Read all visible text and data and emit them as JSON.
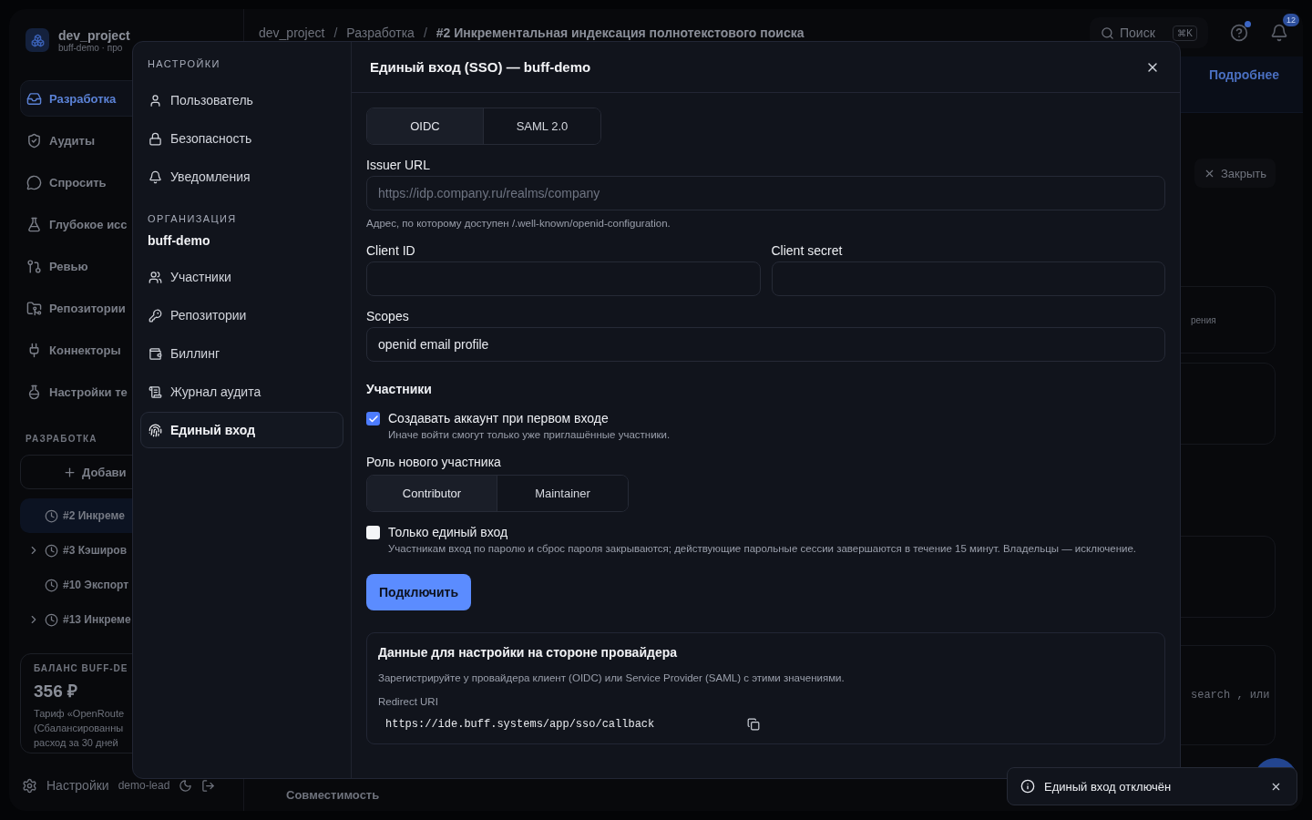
{
  "background": {
    "project": {
      "name": "dev_project",
      "subtitle": "buff-demo · про"
    },
    "nav": [
      {
        "label": "Разработка",
        "selected": true
      },
      {
        "label": "Аудиты",
        "selected": false
      },
      {
        "label": "Спросить",
        "selected": false
      },
      {
        "label": "Глубокое исс",
        "selected": false
      },
      {
        "label": "Ревью",
        "selected": false
      },
      {
        "label": "Репозитории",
        "selected": false
      },
      {
        "label": "Коннекторы",
        "selected": false
      },
      {
        "label": "Настройки те",
        "selected": false
      }
    ],
    "section_title": "РАЗРАБОТКА",
    "add_button": "Добави",
    "tasks": [
      {
        "label": "#2 Инкреме",
        "selected": true,
        "expandable": false
      },
      {
        "label": "#3 Кэширов",
        "selected": false,
        "expandable": true
      },
      {
        "label": "#10 Экспорт",
        "selected": false,
        "expandable": false
      },
      {
        "label": "#13 Инкреме",
        "selected": false,
        "expandable": true
      }
    ],
    "balance": {
      "title": "БАЛАНС BUFF-DE",
      "amount": "356 ₽",
      "lines": [
        "Тариф «OpenRoute",
        "(Сбалансированны",
        "расход за 30 дней"
      ]
    },
    "footer": {
      "settings": "Настройки",
      "user": "demo-lead"
    },
    "breadcrumbs": [
      "dev_project",
      "Разработка",
      "#2 Инкрементальная индексация полнотекстового поиска"
    ],
    "breadcrumb_separator": "/",
    "search": {
      "placeholder": "Поиск",
      "shortcut": "⌘K"
    },
    "notifications_count": "12",
    "banner_link": "Подробнее",
    "close_button": "Закрыть",
    "fragments": [
      "рения",
      "search , или"
    ],
    "bottom_tab": "Совместимость"
  },
  "modal": {
    "sidebar": {
      "title": "НАСТРОЙКИ",
      "items": [
        {
          "label": "Пользователь",
          "selected": false
        },
        {
          "label": "Безопасность",
          "selected": false
        },
        {
          "label": "Уведомления",
          "selected": false
        }
      ],
      "org_title": "ОРГАНИЗАЦИЯ",
      "org_name": "buff-demo",
      "org_items": [
        {
          "label": "Участники",
          "selected": false
        },
        {
          "label": "Репозитории",
          "selected": false
        },
        {
          "label": "Биллинг",
          "selected": false
        },
        {
          "label": "Журнал аудита",
          "selected": false
        },
        {
          "label": "Единый вход",
          "selected": true
        }
      ]
    },
    "title": "Единый вход (SSO) — buff-demo",
    "protocol": [
      {
        "label": "OIDC",
        "selected": true
      },
      {
        "label": "SAML 2.0",
        "selected": false
      }
    ],
    "issuer": {
      "label": "Issuer URL",
      "placeholder": "https://idp.company.ru/realms/company",
      "hint": "Адрес, по которому доступен /.well-known/openid-configuration."
    },
    "client_id": {
      "label": "Client ID"
    },
    "client_secret": {
      "label": "Client secret"
    },
    "scopes": {
      "label": "Scopes",
      "value": "openid email profile"
    },
    "members_title": "Участники",
    "auto_create": {
      "label": "Создавать аккаунт при первом входе",
      "hint": "Иначе войти смогут только уже приглашённые участники.",
      "checked": true
    },
    "role_label": "Роль нового участника",
    "roles": [
      {
        "label": "Contributor",
        "selected": true
      },
      {
        "label": "Maintainer",
        "selected": false
      }
    ],
    "sso_only": {
      "label": "Только единый вход",
      "hint": "Участникам вход по паролю и сброс пароля закрываются; действующие парольные сессии завершаются в течение 15 минут. Владельцы — исключение.",
      "checked": false
    },
    "connect_button": "Подключить",
    "provider_card": {
      "title": "Данные для настройки на стороне провайдера",
      "description": "Зарегистрируйте у провайдера клиент (OIDC) или Service Provider (SAML) с этими значениями.",
      "redirect_label": "Redirect URI",
      "redirect_value": "https://ide.buff.systems/app/sso/callback"
    }
  },
  "toast": {
    "message": "Единый вход отключён"
  }
}
